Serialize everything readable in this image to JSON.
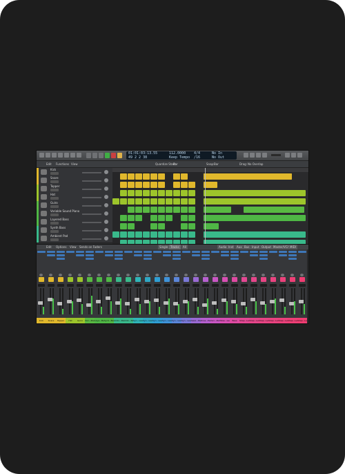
{
  "lcd": {
    "position": "01:01:03:13.55",
    "bars": "49  2  2  38",
    "tempo": "112.0000",
    "tempo_mode": "Keep Tempo",
    "signature": "4/4",
    "division": "/16",
    "key_in": "No In",
    "key_out": "No Out"
  },
  "toolbar": {
    "edit": "Edit",
    "functions": "Functions",
    "view": "View",
    "snap": "Snap:",
    "snap_value": "Bar",
    "drag": "Drag:",
    "drag_value": "No Overlap",
    "quantize_label": "Quantize Start:",
    "quantize_value": "Bar"
  },
  "tracks": [
    {
      "name": "Kick",
      "color": "#e1b82c"
    },
    {
      "name": "Snare",
      "color": "#e1b82c"
    },
    {
      "name": "Topper",
      "color": "#9dc52b"
    },
    {
      "name": "Hat",
      "color": "#9dc52b"
    },
    {
      "name": "Guiro",
      "color": "#59b942"
    },
    {
      "name": "Variable Sound Piano",
      "color": "#4fb745"
    },
    {
      "name": "Layered Bass",
      "color": "#4fb745"
    },
    {
      "name": "Synth Bass",
      "color": "#39b98b"
    },
    {
      "name": "Ambient Pad",
      "color": "#39b98b"
    }
  ],
  "mixer_header": {
    "edit": "Edit",
    "options": "Options",
    "view": "View",
    "sends": "Sends on Faders",
    "single": "Single",
    "tracks": "Tracks",
    "all": "All",
    "filters": [
      "Audio",
      "Inst",
      "Aux",
      "Bus",
      "Input",
      "Output",
      "Master/VCA",
      "MIDI"
    ]
  },
  "strips": [
    {
      "label": "Kick",
      "color": "#e1b82c"
    },
    {
      "label": "Snare",
      "color": "#e1b82c"
    },
    {
      "label": "Topper",
      "color": "#e1b82c"
    },
    {
      "label": "Hat",
      "color": "#9dc52b"
    },
    {
      "label": "Guiro",
      "color": "#9dc52b"
    },
    {
      "label": "Vari...Piano",
      "color": "#59b942"
    },
    {
      "label": "Laye...Bass",
      "color": "#4fb745"
    },
    {
      "label": "Synt...Bass",
      "color": "#4fb745"
    },
    {
      "label": "Ambi...Pad",
      "color": "#39b98b"
    },
    {
      "label": "Ambi...Pad",
      "color": "#39b98b"
    },
    {
      "label": "Syn...Lead",
      "color": "#2fb5b8"
    },
    {
      "label": "Syn...Lead",
      "color": "#2fa7c4"
    },
    {
      "label": "Syn...Lead",
      "color": "#2f9fd4"
    },
    {
      "label": "Syn...Lead",
      "color": "#3f93d9"
    },
    {
      "label": "Syn...Lead",
      "color": "#5b86da"
    },
    {
      "label": "Syn...Lead",
      "color": "#7a78d8"
    },
    {
      "label": "Swel...Pad",
      "color": "#9a6ad4"
    },
    {
      "label": "Drea...Pad",
      "color": "#b660cf"
    },
    {
      "label": "Vari...Pad",
      "color": "#c957c4"
    },
    {
      "label": "Stee...Lead",
      "color": "#d84fb3"
    },
    {
      "label": "Bass",
      "color": "#df4aa2"
    },
    {
      "label": "Shap...Lead",
      "color": "#e44893"
    },
    {
      "label": "Shap...Lead",
      "color": "#e6468a"
    },
    {
      "label": "Shap...Lead",
      "color": "#e84584"
    },
    {
      "label": "Shap...Lead",
      "color": "#ea4380"
    },
    {
      "label": "Shap...Lead",
      "color": "#ec417b"
    },
    {
      "label": "Shap...Lead",
      "color": "#ee3f76"
    },
    {
      "label": "Shap...Lead",
      "color": "#f03d72"
    }
  ]
}
